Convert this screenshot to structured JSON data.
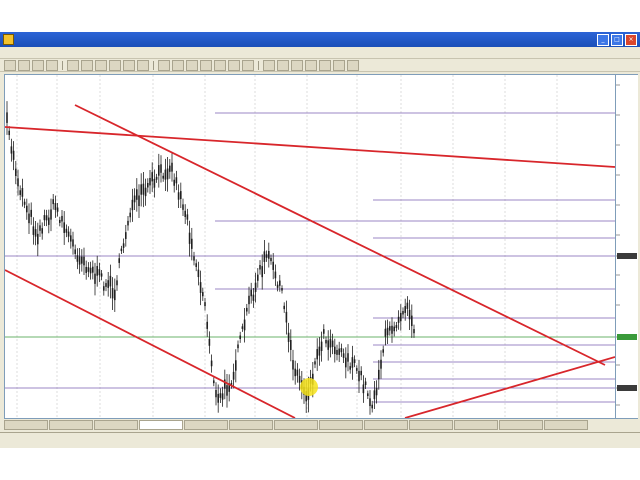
{
  "window": {
    "title": ""
  },
  "menu": {
    "items": [
      "",
      "",
      "",
      "",
      "",
      "",
      "",
      ""
    ]
  },
  "toolbar": {
    "buttons": 24
  },
  "chart_tabs": [],
  "status": [],
  "colors": {
    "trendline": "#d8262b",
    "fib_line": "#7a5fb0",
    "support_line": "#3a9a3a",
    "candle": "#202020",
    "highlight": "#f4e21a"
  },
  "cursor": {
    "icon": "mouse-highlight-icon"
  }
}
